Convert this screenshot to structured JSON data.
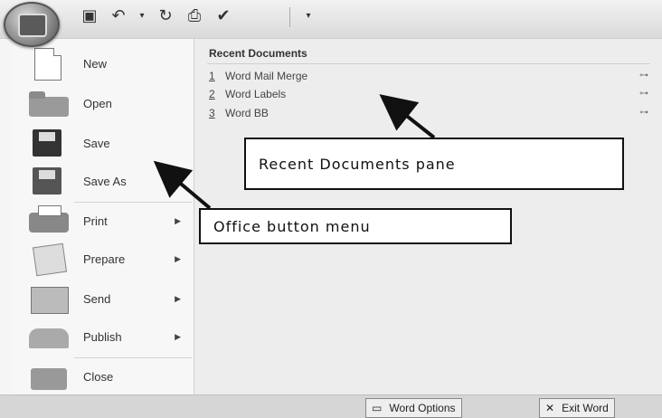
{
  "recent": {
    "title": "Recent Documents",
    "documents": [
      {
        "num": "1",
        "name": "Word Mail Merge"
      },
      {
        "num": "2",
        "name": "Word Labels"
      },
      {
        "num": "3",
        "name": "Word BB"
      }
    ]
  },
  "menu": {
    "items": [
      {
        "label": "New",
        "icon": "new-document-icon"
      },
      {
        "label": "Open",
        "icon": "open-folder-icon"
      },
      {
        "label": "Save",
        "icon": "save-disk-icon"
      },
      {
        "label": "Save As",
        "icon": "save-as-icon"
      },
      {
        "label": "Print",
        "icon": "printer-icon",
        "submenu": true
      },
      {
        "label": "Prepare",
        "icon": "prepare-icon",
        "submenu": true
      },
      {
        "label": "Send",
        "icon": "send-icon",
        "submenu": true
      },
      {
        "label": "Publish",
        "icon": "publish-icon",
        "submenu": true
      },
      {
        "label": "Close",
        "icon": "close-document-icon"
      }
    ]
  },
  "bottom": {
    "options_label": "Word Options",
    "exit_label": "Exit Word"
  },
  "annotations": {
    "recent_pane": "Recent Documents pane",
    "office_menu": "Office button menu"
  }
}
